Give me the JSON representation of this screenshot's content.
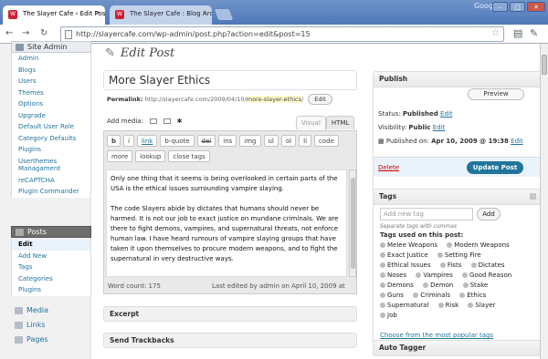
{
  "browser": {
    "tabs": [
      {
        "title": "The Slayer Cafe › Edit Post...",
        "active": true
      },
      {
        "title": "The Slayer Cafe : Blog Arc...",
        "active": false
      }
    ],
    "brand": "Google",
    "url": "http://slayercafe.com/wp-admin/post.php?action=edit&post=15",
    "nav_back": "←",
    "nav_forward": "→",
    "nav_reload": "↻"
  },
  "sidebar": {
    "site_admin_label": "Site Admin",
    "site_admin_items": [
      "Admin",
      "Blogs",
      "Users",
      "Themes",
      "Options",
      "Upgrade",
      "Default User Role",
      "Category Defaults",
      "Plugins",
      "Userthemes Managament",
      "reCAPTCHA",
      "Plugin Commander"
    ],
    "posts_label": "Posts",
    "posts_items": [
      "Edit",
      "Add New",
      "Tags",
      "Categories",
      "Plugins"
    ],
    "media_label": "Media",
    "links_label": "Links",
    "pages_label": "Pages"
  },
  "editor": {
    "heading": "Edit Post",
    "post_title": "More Slayer Ethics",
    "permalink_label": "Permalink:",
    "permalink_base": "http://slayercafe.com/2009/04/10/",
    "permalink_slug": "more-slayer-ethics",
    "permalink_tail": "/",
    "permalink_edit": "Edit",
    "add_media_label": "Add media:",
    "tab_visual": "Visual",
    "tab_html": "HTML",
    "quicktags_row1": [
      "b",
      "i",
      "link",
      "b-quote",
      "del",
      "ins",
      "img",
      "ul",
      "ol",
      "li",
      "code"
    ],
    "quicktags_row2": [
      "more",
      "lookup",
      "close tags"
    ],
    "content": [
      "Only one thing that it seems is being overlooked in certain parts of the USA is the ethical issues surrounding vampire slaying.",
      "The code Slayers abide by dictates that humans should never be harmed. It is not our job to exact justice on mundane criminals. We are there to fight demons, vampires, and supernatural threats, not enforce human law. I have heard rumours of vampire slaying groups that have taken it upon themselves to procure modern weapons, and to fight the supernatural in very destructive ways."
    ],
    "word_count": "Word count: 175",
    "last_edited": "Last edited by admin on April 10, 2009 at",
    "excerpt_label": "Excerpt",
    "trackbacks_label": "Send Trackbacks"
  },
  "publish": {
    "title": "Publish",
    "preview": "Preview",
    "status_label": "Status:",
    "status_value": "Published",
    "status_edit": "Edit",
    "visibility_label": "Visibility:",
    "visibility_value": "Public",
    "visibility_edit": "Edit",
    "published_on_label": "Published on:",
    "published_on_value": "Apr 10, 2009 @ 19:38",
    "published_edit": "Edit",
    "delete": "Delete",
    "update": "Update Post"
  },
  "tags": {
    "title": "Tags",
    "input_placeholder": "Add new tag",
    "add_button": "Add",
    "separator_hint": "Separate tags with commas",
    "used_label": "Tags used on this post:",
    "rows": [
      [
        "Melee Weapons",
        "Modern Weapons"
      ],
      [
        "Exact Justice",
        "Setting Fire"
      ],
      [
        "Ethical Issues",
        "Fists",
        "Dictates"
      ],
      [
        "Noses",
        "Vampires",
        "Good Reason"
      ],
      [
        "Demons",
        "Demon",
        "Stake"
      ],
      [
        "Guns",
        "Criminals",
        "Ethics"
      ],
      [
        "Supernatural",
        "Risk",
        "Slayer"
      ],
      [
        "Job"
      ]
    ],
    "popular_link": "Choose from the most popular tags"
  },
  "autotagger": {
    "title": "Auto Tagger"
  },
  "colors": {
    "accent": "#21759b",
    "titlebar": "#5b82bd",
    "delete": "#cc0000"
  }
}
